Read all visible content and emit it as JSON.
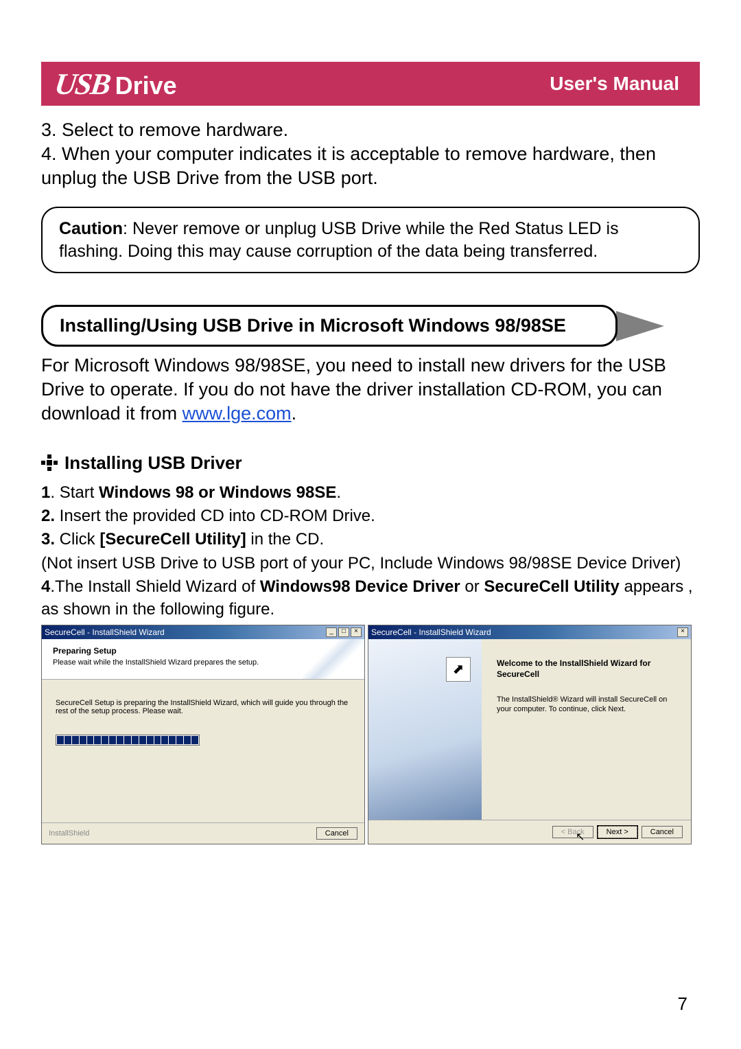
{
  "header": {
    "logo_usb": "USB",
    "logo_drive": "Drive",
    "manual": "User's Manual"
  },
  "intro": {
    "line3": "3. Select to remove hardware.",
    "line4": "4. When your computer indicates it is acceptable to remove hardware, then unplug the USB Drive from the USB port."
  },
  "caution": {
    "label": "Caution",
    "text": ": Never remove or unplug USB Drive while the Red Status LED is flashing. Doing this may cause corruption of the data being transferred."
  },
  "section": {
    "heading": "Installing/Using USB Drive in Microsoft Windows 98/98SE",
    "para_a": "For Microsoft Windows 98/98SE, you need to install new drivers for the USB Drive to operate. If you do not have the driver installation CD-ROM, you can download it from ",
    "link": "www.lge.com",
    "para_b": "."
  },
  "sub": {
    "heading": "Installing USB Driver"
  },
  "steps": {
    "s1a": "1",
    "s1b": ". Start ",
    "s1c": "Windows 98 or Windows 98SE",
    "s1d": ".",
    "s2a": "2.",
    "s2b": " Insert the provided CD into CD-ROM Drive.",
    "s3a": "3.",
    "s3b": " Click ",
    "s3c": "[SecureCell Utility]",
    "s3d": " in the CD.",
    "note": "  (Not insert USB Drive to USB port of your PC, Include Windows 98/98SE Device Driver)",
    "s4a": "4",
    "s4b": ".The Install Shield Wizard of ",
    "s4c": "Windows98 Device Driver",
    "s4d": " or ",
    "s4e": "SecureCell Utility",
    "s4f": " appears , as shown in the following figure."
  },
  "dlg1": {
    "title": "SecureCell - InstallShield Wizard",
    "head": "Preparing Setup",
    "sub": "Please wait while the InstallShield Wizard prepares the setup.",
    "mid": "SecureCell Setup is preparing the InstallShield Wizard, which will guide you through the rest of the setup process. Please wait.",
    "footer_label": "InstallShield",
    "cancel": "Cancel"
  },
  "dlg2": {
    "title": "SecureCell - InstallShield Wizard",
    "welcome": "Welcome to the InstallShield Wizard for SecureCell",
    "desc": "The InstallShield® Wizard will install SecureCell on your computer.  To continue, click Next.",
    "back": "< Back",
    "next": "Next >",
    "cancel": "Cancel"
  },
  "page_number": "7"
}
